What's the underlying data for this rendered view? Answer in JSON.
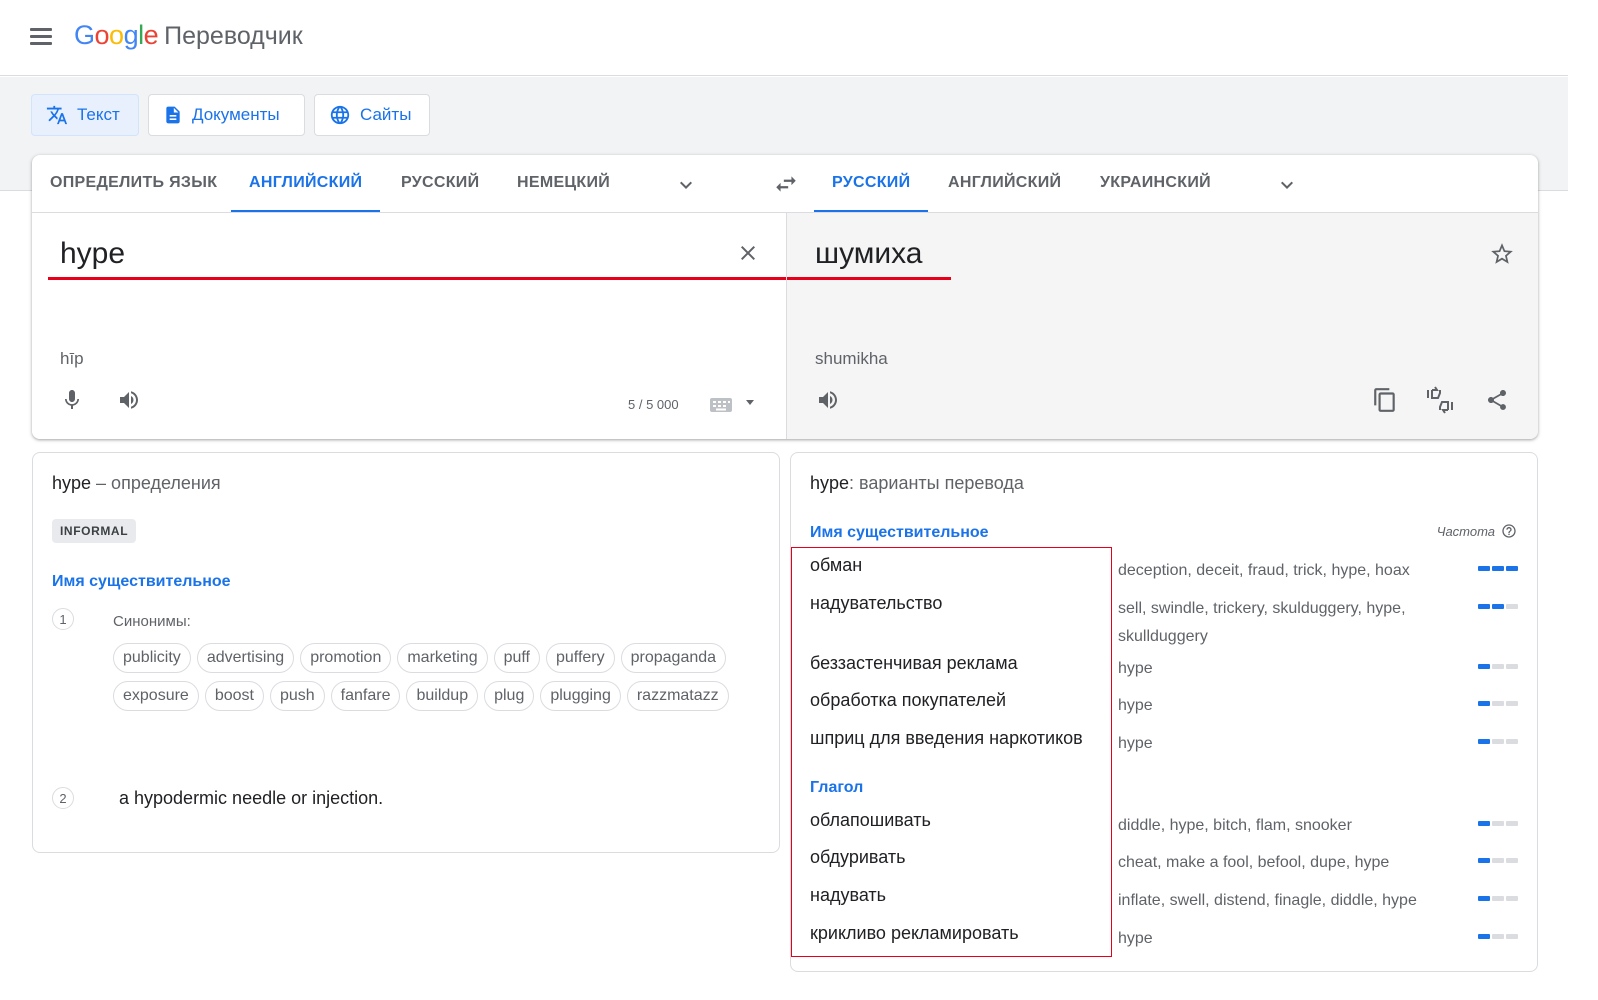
{
  "header": {
    "logo_letters": [
      "G",
      "o",
      "o",
      "g",
      "l",
      "e"
    ],
    "product_name": "Переводчик"
  },
  "modes": [
    {
      "label": "Текст",
      "icon": "translate-icon",
      "active": true
    },
    {
      "label": "Документы",
      "icon": "document-icon",
      "active": false
    },
    {
      "label": "Сайты",
      "icon": "globe-icon",
      "active": false
    }
  ],
  "source_languages": [
    {
      "label": "ОПРЕДЕЛИТЬ ЯЗЫК",
      "active": false
    },
    {
      "label": "АНГЛИЙСКИЙ",
      "active": true
    },
    {
      "label": "РУССКИЙ",
      "active": false
    },
    {
      "label": "НЕМЕЦКИЙ",
      "active": false
    }
  ],
  "target_languages": [
    {
      "label": "РУССКИЙ",
      "active": true
    },
    {
      "label": "АНГЛИЙСКИЙ",
      "active": false
    },
    {
      "label": "УКРАИНСКИЙ",
      "active": false
    }
  ],
  "source": {
    "text": "hype",
    "transliteration": "hīp",
    "char_count": "5 / 5 000"
  },
  "target": {
    "text": "шумиха",
    "transliteration": "shumikha"
  },
  "definitions": {
    "word": "hype",
    "title_suffix": " – определения",
    "register": "INFORMAL",
    "pos": "Имя существительное",
    "sense1_number": "1",
    "synonyms_label": "Синонимы:",
    "synonyms": [
      "publicity",
      "advertising",
      "promotion",
      "marketing",
      "puff",
      "puffery",
      "propaganda",
      "exposure",
      "boost",
      "push",
      "fanfare",
      "buildup",
      "plug",
      "plugging",
      "razzmatazz"
    ],
    "sense2_number": "2",
    "sense2_text": "a hypodermic needle or injection."
  },
  "translations": {
    "word": "hype",
    "title_suffix": ": варианты перевода",
    "frequency_label": "Частота",
    "noun_label": "Имя существительное",
    "verb_label": "Глагол",
    "nouns": [
      {
        "word": "обман",
        "back": "deception, deceit, fraud, trick, hype, hoax",
        "freq": 3
      },
      {
        "word": "надувательство",
        "back": "sell, swindle, trickery, skulduggery, hype, skullduggery",
        "freq": 2
      },
      {
        "word": "беззастенчивая реклама",
        "back": "hype",
        "freq": 1
      },
      {
        "word": "обработка покупателей",
        "back": "hype",
        "freq": 1
      },
      {
        "word": "шприц для введения наркотиков",
        "back": "hype",
        "freq": 1
      }
    ],
    "verbs": [
      {
        "word": "облапошивать",
        "back": "diddle, hype, bitch, flam, snooker",
        "freq": 1
      },
      {
        "word": "обдуривать",
        "back": "cheat, make a fool, befool, dupe, hype",
        "freq": 1
      },
      {
        "word": "надувать",
        "back": "inflate, swell, distend, finagle, diddle, hype",
        "freq": 1
      },
      {
        "word": "крикливо рекламировать",
        "back": "hype",
        "freq": 1
      }
    ]
  },
  "colors": {
    "accent": "#1a73e8",
    "highlight_red": "#e8001b",
    "muted": "#5f6368"
  }
}
